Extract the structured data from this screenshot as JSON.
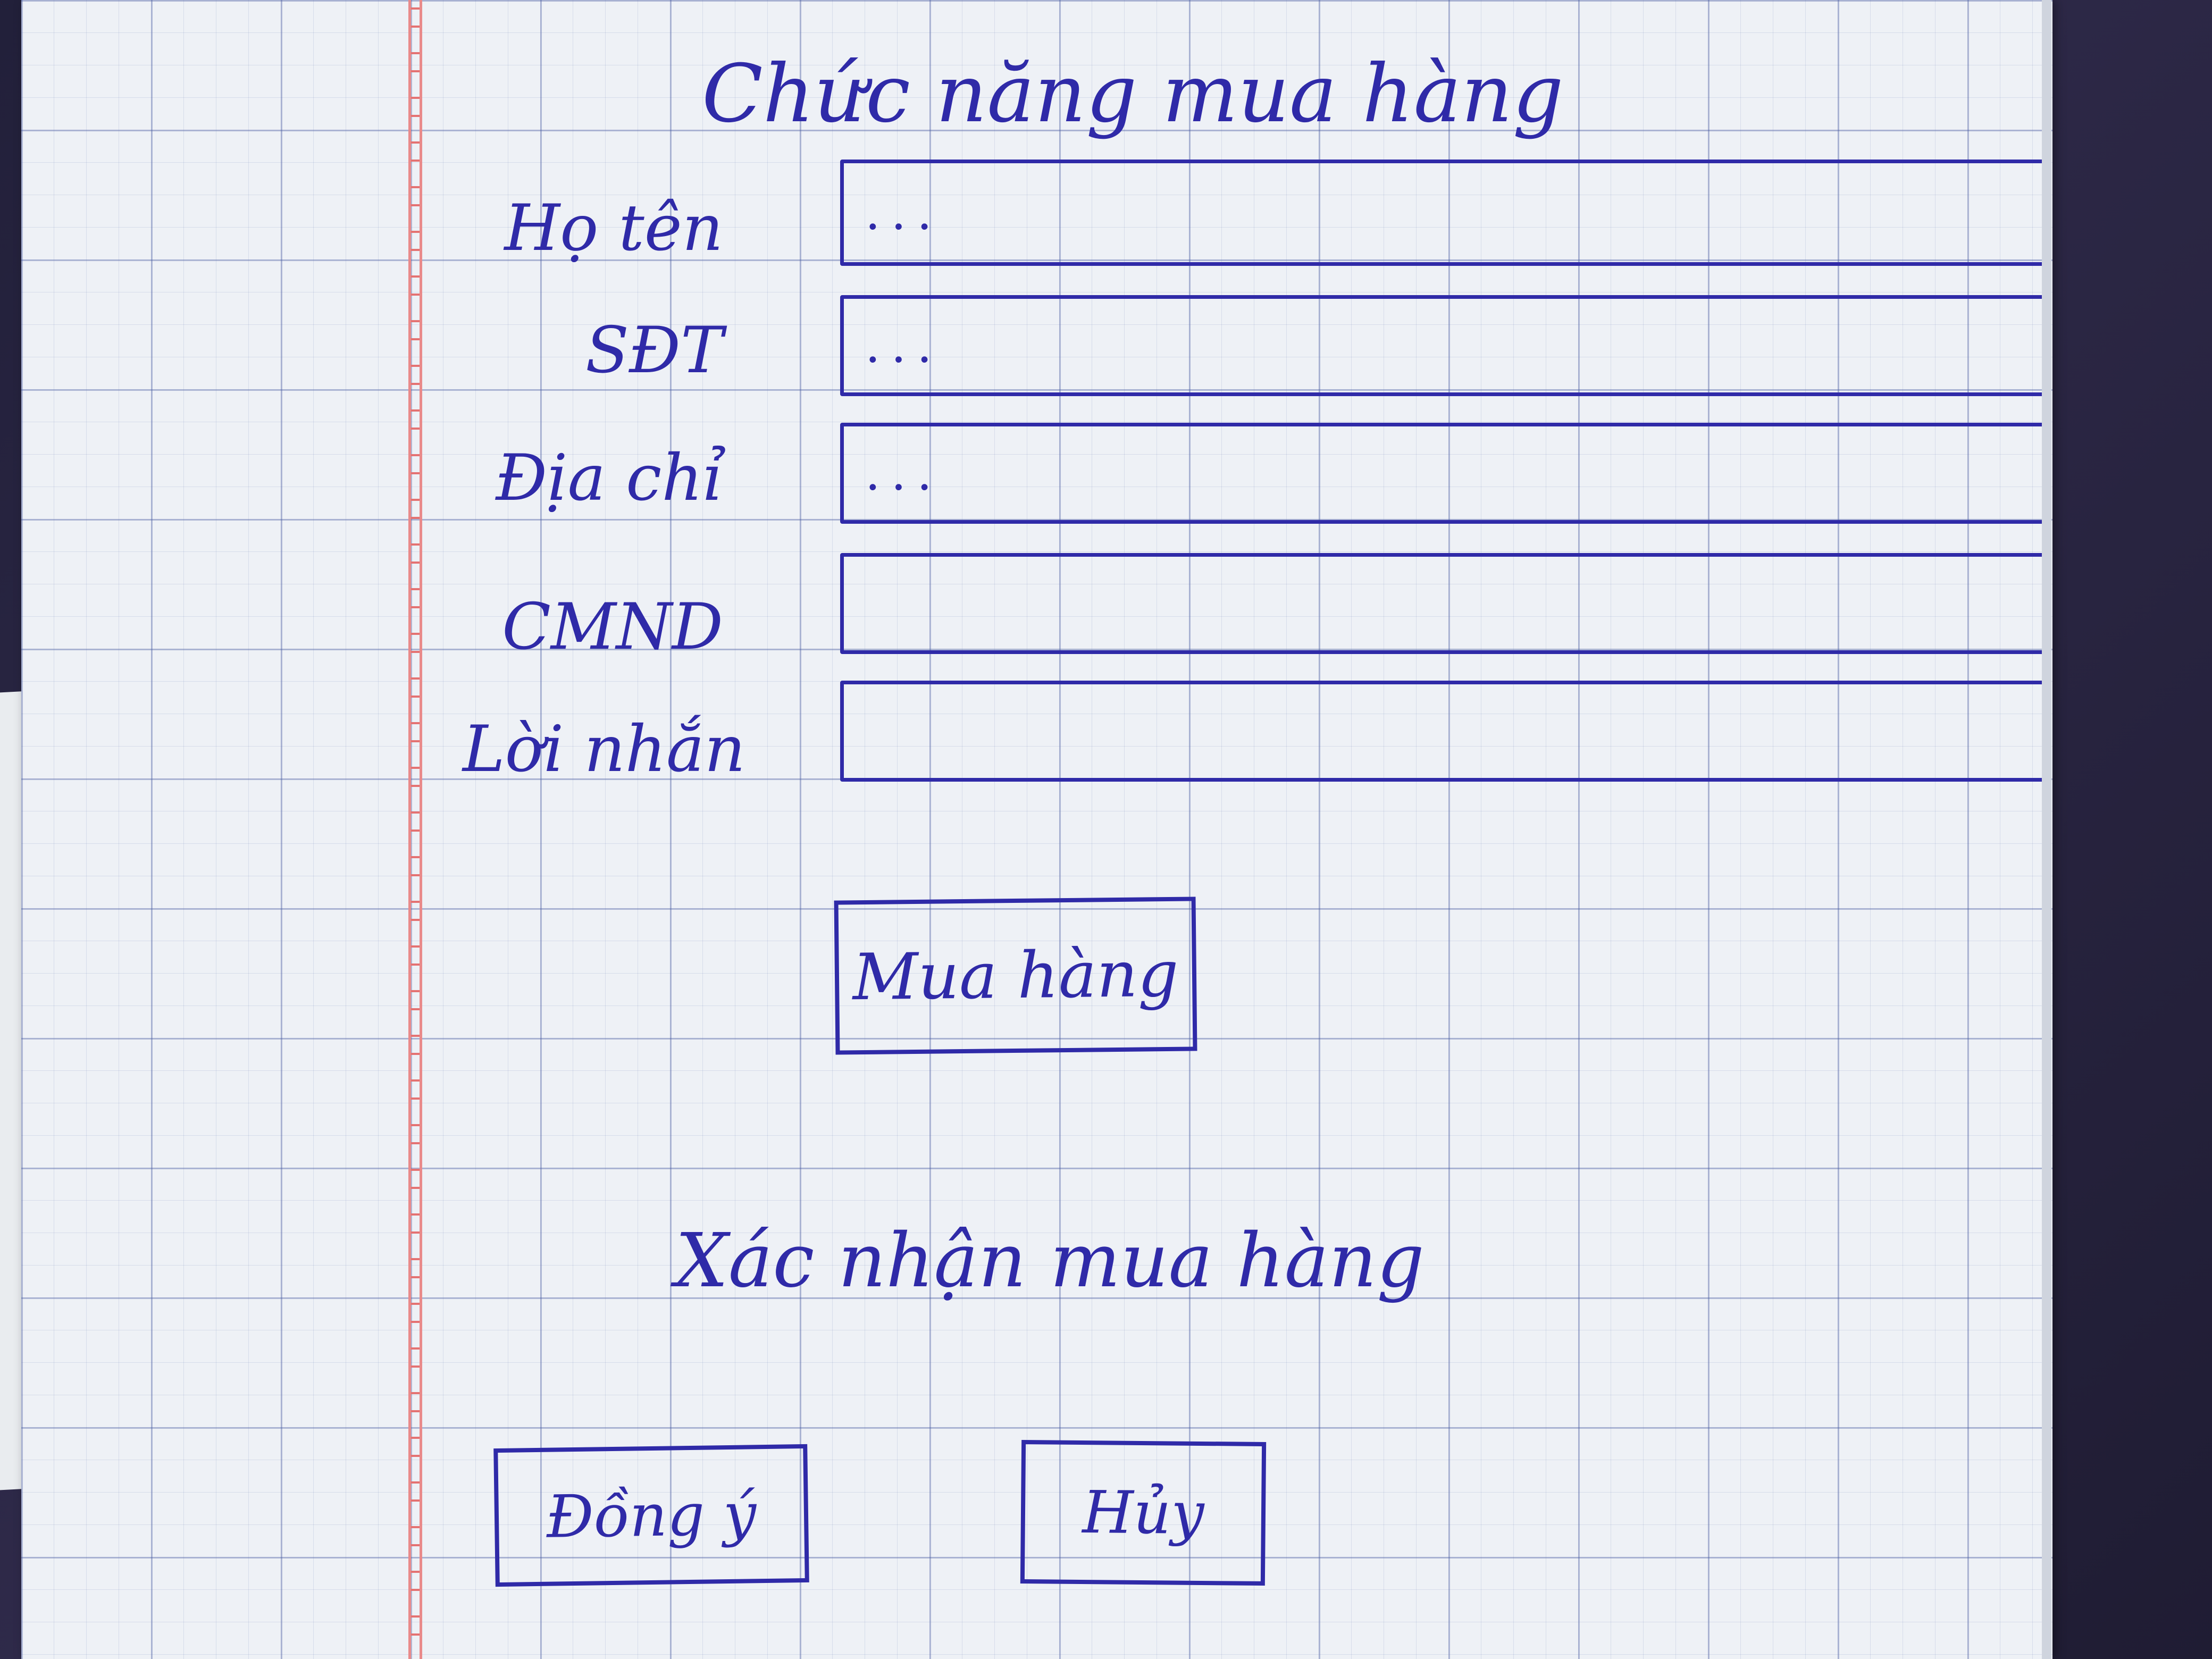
{
  "form": {
    "title": "Chức năng mua hàng",
    "fields": [
      {
        "label": "Họ tên",
        "placeholder": "..."
      },
      {
        "label": "SĐT",
        "placeholder": "..."
      },
      {
        "label": "Địa chỉ",
        "placeholder": "..."
      },
      {
        "label": "CMND",
        "placeholder": ""
      },
      {
        "label": "Lời nhắn",
        "placeholder": ""
      }
    ],
    "submit_label": "Mua hàng"
  },
  "confirm": {
    "title": "Xác nhận mua hàng",
    "ok_label": "Đồng ý",
    "cancel_label": "Hủy"
  },
  "colors": {
    "ink": "#2f2aa8",
    "paper": "#eef1f6",
    "grid": "#465aa0",
    "margin": "#e47272"
  }
}
